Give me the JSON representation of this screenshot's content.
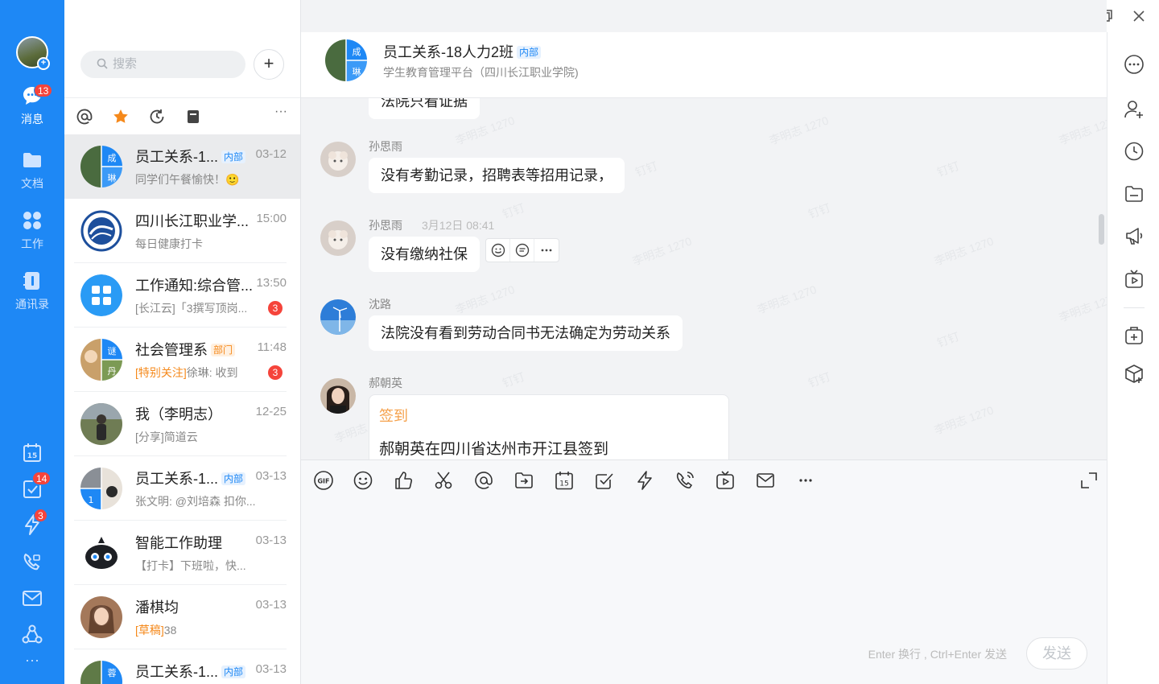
{
  "nav": {
    "messages_label": "消息",
    "messages_badge": "13",
    "docs_label": "文档",
    "work_label": "工作",
    "contacts_label": "通讯录",
    "todo_badge": "14",
    "ding_badge": "3",
    "more_glyph": "···"
  },
  "search": {
    "placeholder": "搜索"
  },
  "conversations": [
    {
      "name": "员工关系-1...",
      "tag": "内部",
      "time": "03-12",
      "preview": "同学们午餐愉快！🙂",
      "prefix": "",
      "unread": ""
    },
    {
      "name": "四川长江职业学...",
      "tag": "",
      "time": "15:00",
      "preview": "每日健康打卡",
      "prefix": "",
      "unread": ""
    },
    {
      "name": "工作通知:综合管...",
      "tag": "",
      "time": "13:50",
      "preview": "[长江云]「3撰写顶岗...",
      "prefix": "",
      "unread": "3"
    },
    {
      "name": "社会管理系",
      "tag": "部门",
      "time": "11:48",
      "preview": "徐琳: 收到",
      "prefix": "[特别关注]",
      "unread": "3"
    },
    {
      "name": "我（李明志）",
      "tag": "",
      "time": "12-25",
      "preview": "[分享]简道云",
      "prefix": "",
      "unread": ""
    },
    {
      "name": "员工关系-1...",
      "tag": "内部",
      "time": "03-13",
      "preview": "张文明: @刘培森 扣你...",
      "prefix": "",
      "unread": ""
    },
    {
      "name": "智能工作助理",
      "tag": "",
      "time": "03-13",
      "preview": "【打卡】下班啦，快...",
      "prefix": "",
      "unread": ""
    },
    {
      "name": "潘棋均",
      "tag": "",
      "time": "03-13",
      "preview": "38",
      "prefix": "[草稿]",
      "unread": ""
    },
    {
      "name": "员工关系-1...",
      "tag": "内部",
      "time": "03-13",
      "preview": "",
      "prefix": "",
      "unread": ""
    }
  ],
  "avatar_chars": {
    "cheng": "成",
    "lin": "琳",
    "mi": "谜",
    "dan": "丹",
    "one": "1",
    "rong": "蓉"
  },
  "chat": {
    "title": "员工关系-18人力2班",
    "title_tag": "内部",
    "subtitle": "学生教育管理平台（四川长江职业学院)",
    "partial_message": "法院只看证据",
    "messages": [
      {
        "sender": "孙思雨",
        "time": "",
        "text": "没有考勤记录，招聘表等招用记录，"
      },
      {
        "sender": "孙思雨",
        "time": "3月12日 08:41",
        "text": "没有缴纳社保"
      },
      {
        "sender": "沈路",
        "time": "",
        "text": "法院没有看到劳动合同书无法确定为劳动关系"
      },
      {
        "sender": "郝朝英",
        "time": "",
        "text": ""
      }
    ],
    "card": {
      "kind": "签到",
      "detail": "郝朝英在四川省达州市开江县签到"
    },
    "watermark_name": "李明志 1270",
    "watermark_short": "钉钉"
  },
  "composer": {
    "gif_label": "GIF",
    "calendar_day": "15",
    "hint": "Enter 换行 , Ctrl+Enter 发送",
    "send_label": "发送"
  },
  "colors": {
    "accent": "#1e88f5",
    "badge": "#f5443b",
    "highlight": "#f5891b"
  }
}
